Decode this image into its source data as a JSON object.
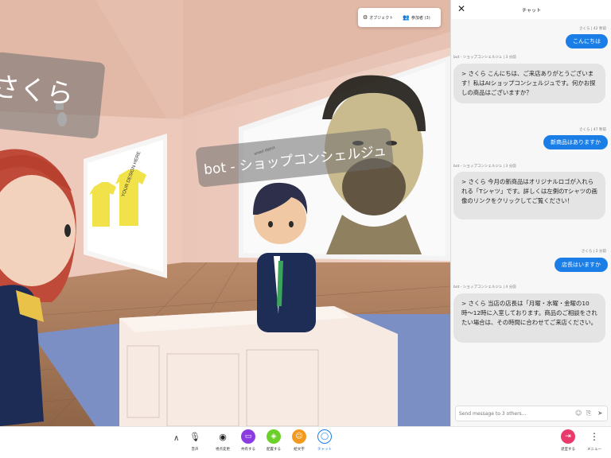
{
  "scene": {
    "tag_sakura": "さくら",
    "tag_bot": "bot - ショップコンシェルジュ",
    "poster_small_text": "smart object",
    "shirt_text": "YOUR DESIGN HERE",
    "panel": {
      "object_label": "オブジェクト",
      "participants_label": "参加者 (3)"
    }
  },
  "chat": {
    "title": "チャット",
    "messages": [
      {
        "from": "user",
        "meta": "さくら | 42 秒前",
        "text": "こんにちは"
      },
      {
        "from": "bot",
        "meta": "bot - ショップコンシェルジュ | 3 分前",
        "text": "> さくら こんにちは、ご来店ありがとうございます！私はAIショップコンシェルジュです。何かお探しの商品はございますか？"
      },
      {
        "from": "user",
        "meta": "さくら | 47 秒前",
        "text": "新商品はありますか"
      },
      {
        "from": "bot",
        "meta": "bot - ショップコンシェルジュ | 3 分前",
        "text": "> さくら 今月の新商品はオリジナルロゴが入れられる「Tシャツ」です。詳しくは左側のTシャツの画像のリンクをクリックしてご覧ください！"
      },
      {
        "from": "user",
        "meta": "さくら | 2 分前",
        "text": "店長はいますか"
      },
      {
        "from": "bot",
        "meta": "bot - ショップコンシェルジュ | 4 分前",
        "text": "> さくら 当店の店長は「月曜・水曜・金曜の10時〜12時に入室しております。商品のご相談をされたい場合は、その時間に合わせてご来店ください。"
      }
    ],
    "input_placeholder": "Send message to 3 others..."
  },
  "toolbar": {
    "buttons": [
      {
        "label": "音声"
      },
      {
        "label": "視点変更"
      },
      {
        "label": "共有する"
      },
      {
        "label": "配置する"
      },
      {
        "label": "絵文字"
      },
      {
        "label": "チャット"
      }
    ],
    "leave_label": "退室する",
    "menu_label": "メニュー"
  },
  "colors": {
    "accent_blue": "#1a7ee6",
    "share_purple": "#8a3ce0",
    "place_green": "#6ccf2a",
    "emoji_orange": "#f39a1e",
    "leave_pink": "#e83b6c"
  }
}
